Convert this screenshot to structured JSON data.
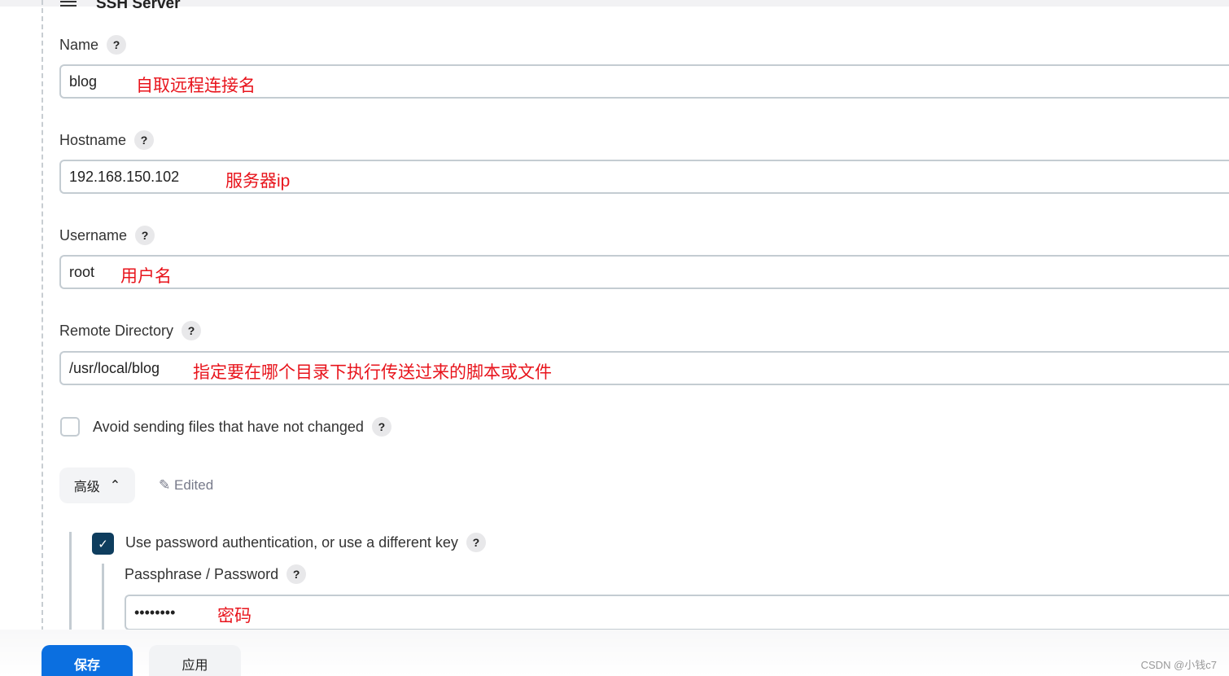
{
  "section_title": "SSH Server",
  "fields": [
    {
      "label": "Name",
      "value": "blog",
      "note": "自取远程连接名"
    },
    {
      "label": "Hostname",
      "value": "192.168.150.102",
      "note": "服务器ip"
    },
    {
      "label": "Username",
      "value": "root",
      "note": "用户名"
    },
    {
      "label": "Remote Directory",
      "value": "/usr/local/blog",
      "note": "指定要在哪个目录下执行传送过来的脚本或文件"
    }
  ],
  "help": "?",
  "avoid_sending": {
    "label": "Avoid sending files that have not changed",
    "checked": false
  },
  "advanced": {
    "label": "高级",
    "edited": "Edited"
  },
  "use_password": {
    "label": "Use password authentication, or use a different key",
    "checked": true
  },
  "passphrase": {
    "label": "Passphrase / Password",
    "value": "••••••••",
    "note": "密码"
  },
  "footer": {
    "save": "保存",
    "apply": "应用"
  },
  "watermark": "CSDN @小钱c7",
  "colors": {
    "primary": "#0b6fe0",
    "annotation": "#e8141c",
    "checkbox": "#0e3d5e"
  }
}
